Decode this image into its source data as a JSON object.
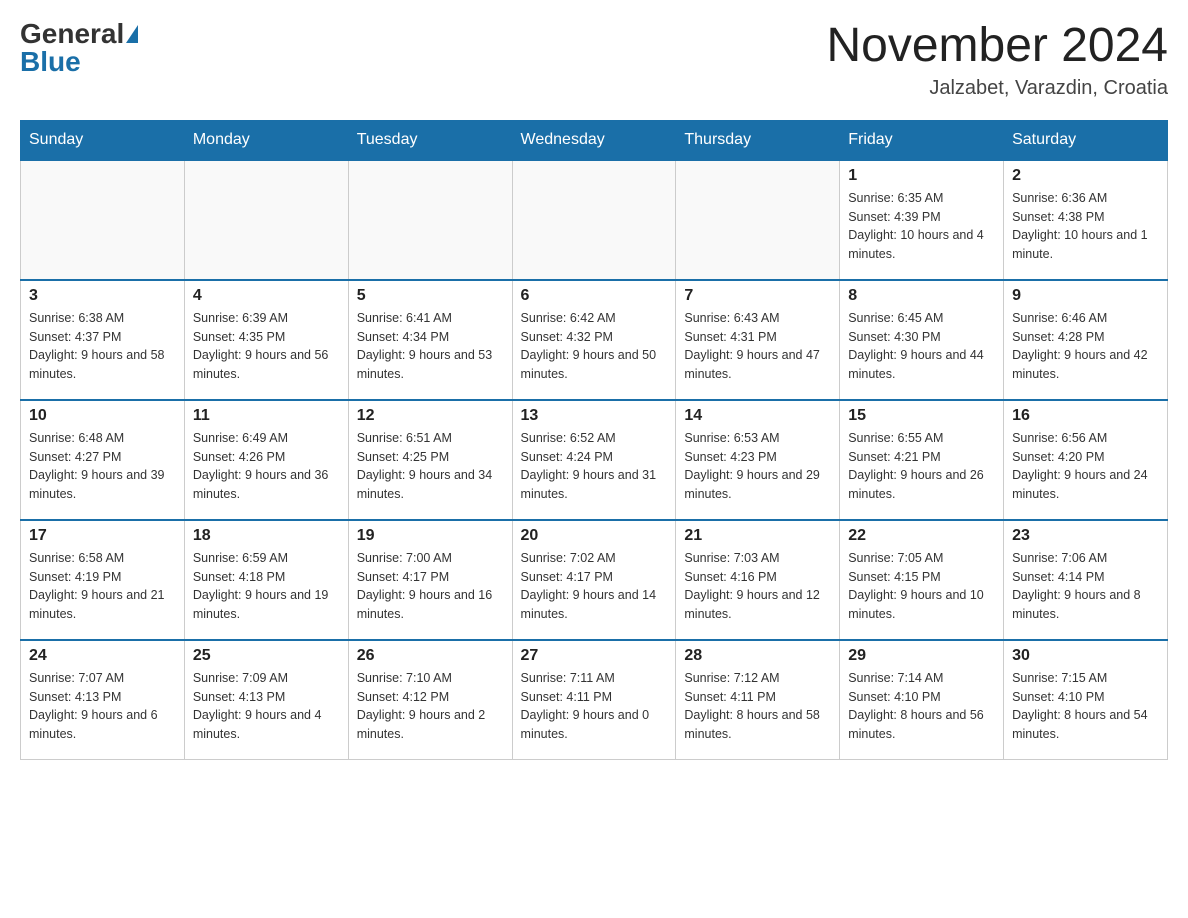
{
  "header": {
    "logo_general": "General",
    "logo_blue": "Blue",
    "month_title": "November 2024",
    "location": "Jalzabet, Varazdin, Croatia"
  },
  "days_of_week": [
    "Sunday",
    "Monday",
    "Tuesday",
    "Wednesday",
    "Thursday",
    "Friday",
    "Saturday"
  ],
  "weeks": [
    [
      {
        "day": "",
        "sunrise": "",
        "sunset": "",
        "daylight": ""
      },
      {
        "day": "",
        "sunrise": "",
        "sunset": "",
        "daylight": ""
      },
      {
        "day": "",
        "sunrise": "",
        "sunset": "",
        "daylight": ""
      },
      {
        "day": "",
        "sunrise": "",
        "sunset": "",
        "daylight": ""
      },
      {
        "day": "",
        "sunrise": "",
        "sunset": "",
        "daylight": ""
      },
      {
        "day": "1",
        "sunrise": "Sunrise: 6:35 AM",
        "sunset": "Sunset: 4:39 PM",
        "daylight": "Daylight: 10 hours and 4 minutes."
      },
      {
        "day": "2",
        "sunrise": "Sunrise: 6:36 AM",
        "sunset": "Sunset: 4:38 PM",
        "daylight": "Daylight: 10 hours and 1 minute."
      }
    ],
    [
      {
        "day": "3",
        "sunrise": "Sunrise: 6:38 AM",
        "sunset": "Sunset: 4:37 PM",
        "daylight": "Daylight: 9 hours and 58 minutes."
      },
      {
        "day": "4",
        "sunrise": "Sunrise: 6:39 AM",
        "sunset": "Sunset: 4:35 PM",
        "daylight": "Daylight: 9 hours and 56 minutes."
      },
      {
        "day": "5",
        "sunrise": "Sunrise: 6:41 AM",
        "sunset": "Sunset: 4:34 PM",
        "daylight": "Daylight: 9 hours and 53 minutes."
      },
      {
        "day": "6",
        "sunrise": "Sunrise: 6:42 AM",
        "sunset": "Sunset: 4:32 PM",
        "daylight": "Daylight: 9 hours and 50 minutes."
      },
      {
        "day": "7",
        "sunrise": "Sunrise: 6:43 AM",
        "sunset": "Sunset: 4:31 PM",
        "daylight": "Daylight: 9 hours and 47 minutes."
      },
      {
        "day": "8",
        "sunrise": "Sunrise: 6:45 AM",
        "sunset": "Sunset: 4:30 PM",
        "daylight": "Daylight: 9 hours and 44 minutes."
      },
      {
        "day": "9",
        "sunrise": "Sunrise: 6:46 AM",
        "sunset": "Sunset: 4:28 PM",
        "daylight": "Daylight: 9 hours and 42 minutes."
      }
    ],
    [
      {
        "day": "10",
        "sunrise": "Sunrise: 6:48 AM",
        "sunset": "Sunset: 4:27 PM",
        "daylight": "Daylight: 9 hours and 39 minutes."
      },
      {
        "day": "11",
        "sunrise": "Sunrise: 6:49 AM",
        "sunset": "Sunset: 4:26 PM",
        "daylight": "Daylight: 9 hours and 36 minutes."
      },
      {
        "day": "12",
        "sunrise": "Sunrise: 6:51 AM",
        "sunset": "Sunset: 4:25 PM",
        "daylight": "Daylight: 9 hours and 34 minutes."
      },
      {
        "day": "13",
        "sunrise": "Sunrise: 6:52 AM",
        "sunset": "Sunset: 4:24 PM",
        "daylight": "Daylight: 9 hours and 31 minutes."
      },
      {
        "day": "14",
        "sunrise": "Sunrise: 6:53 AM",
        "sunset": "Sunset: 4:23 PM",
        "daylight": "Daylight: 9 hours and 29 minutes."
      },
      {
        "day": "15",
        "sunrise": "Sunrise: 6:55 AM",
        "sunset": "Sunset: 4:21 PM",
        "daylight": "Daylight: 9 hours and 26 minutes."
      },
      {
        "day": "16",
        "sunrise": "Sunrise: 6:56 AM",
        "sunset": "Sunset: 4:20 PM",
        "daylight": "Daylight: 9 hours and 24 minutes."
      }
    ],
    [
      {
        "day": "17",
        "sunrise": "Sunrise: 6:58 AM",
        "sunset": "Sunset: 4:19 PM",
        "daylight": "Daylight: 9 hours and 21 minutes."
      },
      {
        "day": "18",
        "sunrise": "Sunrise: 6:59 AM",
        "sunset": "Sunset: 4:18 PM",
        "daylight": "Daylight: 9 hours and 19 minutes."
      },
      {
        "day": "19",
        "sunrise": "Sunrise: 7:00 AM",
        "sunset": "Sunset: 4:17 PM",
        "daylight": "Daylight: 9 hours and 16 minutes."
      },
      {
        "day": "20",
        "sunrise": "Sunrise: 7:02 AM",
        "sunset": "Sunset: 4:17 PM",
        "daylight": "Daylight: 9 hours and 14 minutes."
      },
      {
        "day": "21",
        "sunrise": "Sunrise: 7:03 AM",
        "sunset": "Sunset: 4:16 PM",
        "daylight": "Daylight: 9 hours and 12 minutes."
      },
      {
        "day": "22",
        "sunrise": "Sunrise: 7:05 AM",
        "sunset": "Sunset: 4:15 PM",
        "daylight": "Daylight: 9 hours and 10 minutes."
      },
      {
        "day": "23",
        "sunrise": "Sunrise: 7:06 AM",
        "sunset": "Sunset: 4:14 PM",
        "daylight": "Daylight: 9 hours and 8 minutes."
      }
    ],
    [
      {
        "day": "24",
        "sunrise": "Sunrise: 7:07 AM",
        "sunset": "Sunset: 4:13 PM",
        "daylight": "Daylight: 9 hours and 6 minutes."
      },
      {
        "day": "25",
        "sunrise": "Sunrise: 7:09 AM",
        "sunset": "Sunset: 4:13 PM",
        "daylight": "Daylight: 9 hours and 4 minutes."
      },
      {
        "day": "26",
        "sunrise": "Sunrise: 7:10 AM",
        "sunset": "Sunset: 4:12 PM",
        "daylight": "Daylight: 9 hours and 2 minutes."
      },
      {
        "day": "27",
        "sunrise": "Sunrise: 7:11 AM",
        "sunset": "Sunset: 4:11 PM",
        "daylight": "Daylight: 9 hours and 0 minutes."
      },
      {
        "day": "28",
        "sunrise": "Sunrise: 7:12 AM",
        "sunset": "Sunset: 4:11 PM",
        "daylight": "Daylight: 8 hours and 58 minutes."
      },
      {
        "day": "29",
        "sunrise": "Sunrise: 7:14 AM",
        "sunset": "Sunset: 4:10 PM",
        "daylight": "Daylight: 8 hours and 56 minutes."
      },
      {
        "day": "30",
        "sunrise": "Sunrise: 7:15 AM",
        "sunset": "Sunset: 4:10 PM",
        "daylight": "Daylight: 8 hours and 54 minutes."
      }
    ]
  ]
}
